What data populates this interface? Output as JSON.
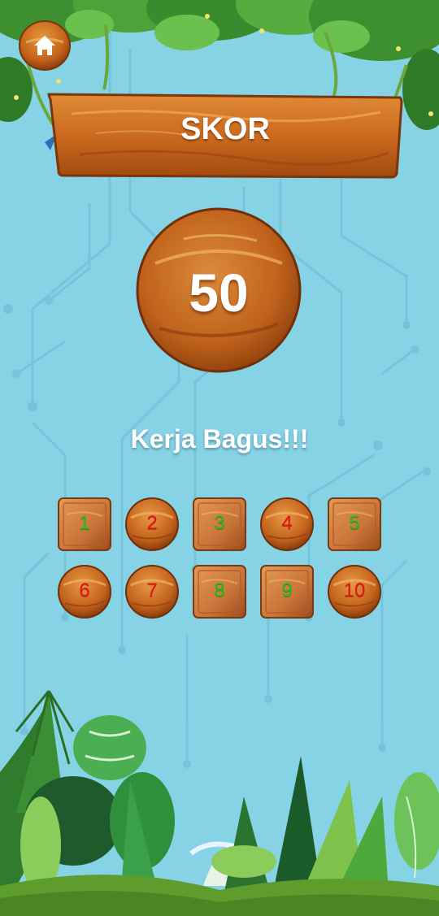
{
  "header": {
    "home_icon": "home-icon",
    "title": "SKOR"
  },
  "score": {
    "value": "50"
  },
  "message": "Kerja Bagus!!!",
  "colors": {
    "sky": "#86d3e6",
    "wood": "#c56a1d",
    "correct": "#17c21a",
    "wrong": "#e51414"
  },
  "questions": [
    {
      "label": "1",
      "result": "correct",
      "shape": "square"
    },
    {
      "label": "2",
      "result": "wrong",
      "shape": "round"
    },
    {
      "label": "3",
      "result": "correct",
      "shape": "square"
    },
    {
      "label": "4",
      "result": "wrong",
      "shape": "round"
    },
    {
      "label": "5",
      "result": "correct",
      "shape": "square"
    },
    {
      "label": "6",
      "result": "wrong",
      "shape": "round"
    },
    {
      "label": "7",
      "result": "wrong",
      "shape": "round"
    },
    {
      "label": "8",
      "result": "correct",
      "shape": "square"
    },
    {
      "label": "9",
      "result": "correct",
      "shape": "square"
    },
    {
      "label": "10",
      "result": "wrong",
      "shape": "round"
    }
  ]
}
